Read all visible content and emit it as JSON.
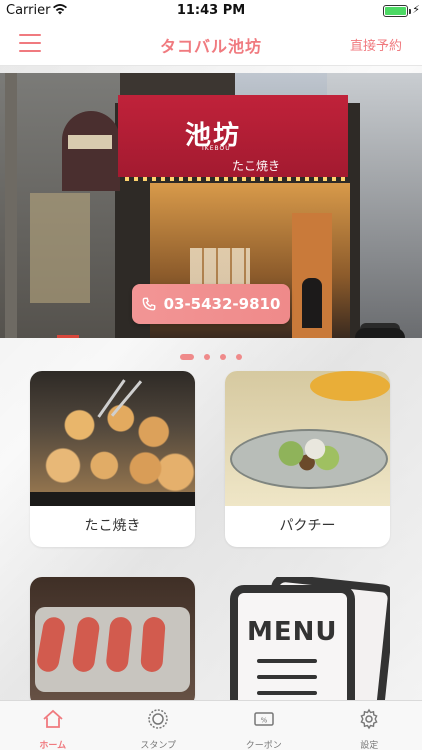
{
  "status_bar": {
    "carrier": "Carrier",
    "time": "11:43 PM"
  },
  "header": {
    "title": "タコバル池坊",
    "reserve_label": "直接予約"
  },
  "hero": {
    "sign_text": "池坊",
    "sign_romaji": "IKEBOU",
    "sign_takoyaki": "たこ焼き",
    "phone": "03-5432-9810",
    "slides": 4,
    "active_slide": 1
  },
  "menu_cards": [
    {
      "label": "たこ焼き"
    },
    {
      "label": "パクチー"
    },
    {
      "label": ""
    },
    {
      "label": ""
    }
  ],
  "menu_card_art": {
    "word": "MENU"
  },
  "tab_bar": {
    "tabs": [
      {
        "label": "ホーム",
        "icon": "home-icon",
        "active": true
      },
      {
        "label": "スタンプ",
        "icon": "stamp-icon",
        "active": false
      },
      {
        "label": "クーポン",
        "icon": "coupon-icon",
        "active": false
      },
      {
        "label": "設定",
        "icon": "gear-icon",
        "active": false
      }
    ]
  },
  "colors": {
    "accent": "#f07a7f",
    "battery": "#4cd964"
  }
}
